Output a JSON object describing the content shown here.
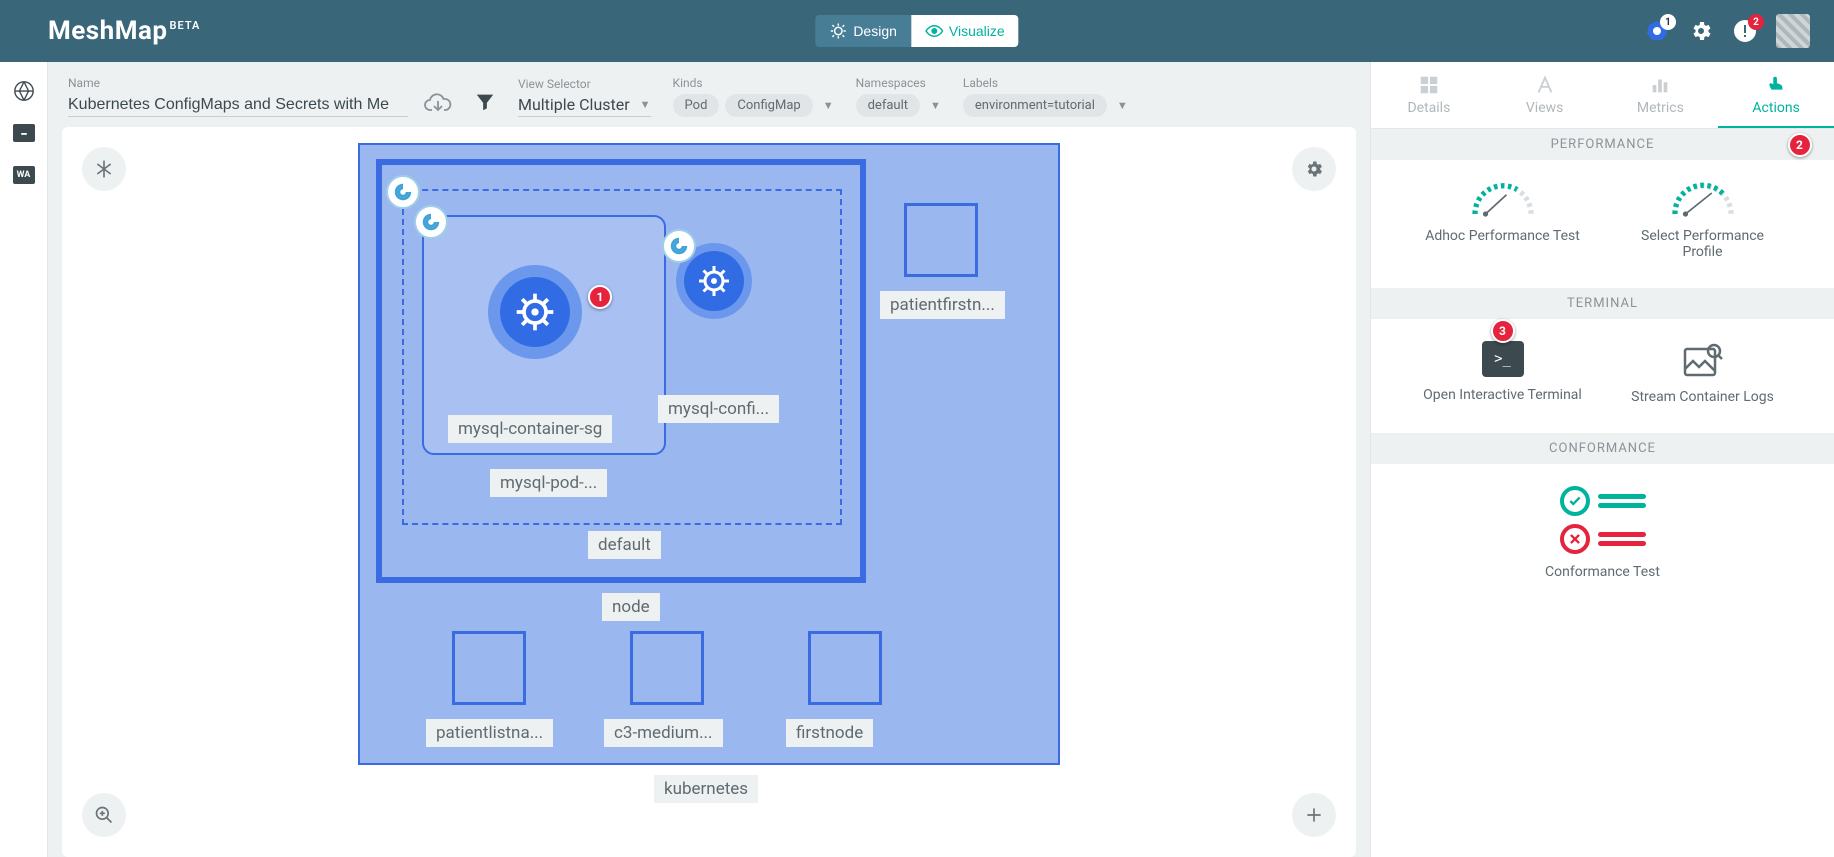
{
  "brand": {
    "name": "MeshMap",
    "tag": "BETA"
  },
  "modes": {
    "design": "Design",
    "visualize": "Visualize"
  },
  "topbar": {
    "k8s_badge": "1",
    "notif_badge": "2"
  },
  "filters": {
    "name_label": "Name",
    "name_value": "Kubernetes ConfigMaps and Secrets with Me",
    "view_label": "View Selector",
    "view_value": "Multiple Cluster",
    "kinds_label": "Kinds",
    "kinds": [
      "Pod",
      "ConfigMap"
    ],
    "ns_label": "Namespaces",
    "ns_value": "default",
    "labels_label": "Labels",
    "labels_value": "environment=tutorial"
  },
  "diagram": {
    "cluster": "kubernetes",
    "node": "node",
    "namespace": "default",
    "pod": "mysql-pod-...",
    "container": "mysql-container-sg",
    "configmap": "mysql-confi...",
    "secret": "patientfirstn...",
    "bottom_nodes": [
      "patientlistna...",
      "c3-medium...",
      "firstnode"
    ],
    "callout1": "1"
  },
  "tabs": {
    "details": "Details",
    "views": "Views",
    "metrics": "Metrics",
    "actions": "Actions"
  },
  "panel": {
    "perf_head": "PERFORMANCE",
    "perf_badge": "2",
    "perf_adhoc": "Adhoc Performance Test",
    "perf_select": "Select Performance Profile",
    "term_head": "TERMINAL",
    "term_badge": "3",
    "term_open": "Open Interactive Terminal",
    "term_stream": "Stream Container Logs",
    "conf_head": "CONFORMANCE",
    "conf_test": "Conformance Test"
  }
}
